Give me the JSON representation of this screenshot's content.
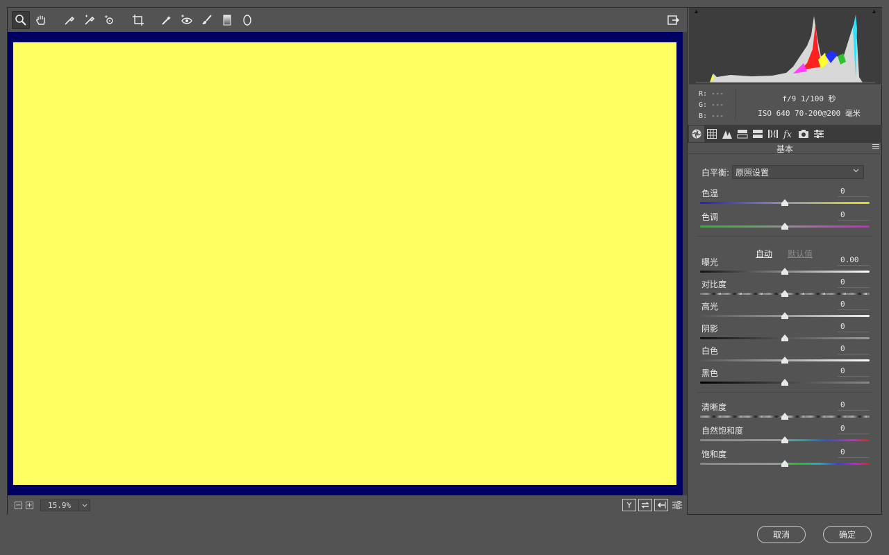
{
  "toolbar": {
    "tools": [
      "zoom-tool-icon",
      "hand-tool-icon",
      "white-balance-tool-icon",
      "color-sampler-tool-icon",
      "targeted-adjustment-tool-icon",
      "crop-tool-icon",
      "spot-removal-tool-icon",
      "red-eye-tool-icon",
      "adjustment-brush-icon",
      "graduated-filter-icon",
      "radial-filter-icon"
    ]
  },
  "canvas": {
    "frame_color": "#000064",
    "image_color": "#ffff62"
  },
  "status": {
    "zoom_value": "15.9%",
    "minus": "−",
    "plus": "+"
  },
  "view_buttons": {
    "y_label": "Y"
  },
  "info": {
    "r": "R: ---",
    "g": "G: ---",
    "b": "B: ---",
    "aperture_shutter": "f/9  1/100 秒",
    "iso_lens": "ISO 640  70-200@200 毫米"
  },
  "panel": {
    "title": "基本",
    "white_balance_label": "白平衡:",
    "white_balance_value": "原照设置",
    "auto_label": "自动",
    "default_label": "默认值",
    "sliders": {
      "temp": {
        "label": "色温",
        "value": "0"
      },
      "tint": {
        "label": "色调",
        "value": "0"
      },
      "exposure": {
        "label": "曝光",
        "value": "0.00"
      },
      "contrast": {
        "label": "对比度",
        "value": "0"
      },
      "highlights": {
        "label": "高光",
        "value": "0"
      },
      "shadows": {
        "label": "阴影",
        "value": "0"
      },
      "whites": {
        "label": "白色",
        "value": "0"
      },
      "blacks": {
        "label": "黑色",
        "value": "0"
      },
      "clarity": {
        "label": "清晰度",
        "value": "0"
      },
      "vibrance": {
        "label": "自然饱和度",
        "value": "0"
      },
      "saturation": {
        "label": "饱和度",
        "value": "0"
      }
    }
  },
  "footer": {
    "cancel": "取消",
    "ok": "确定"
  }
}
